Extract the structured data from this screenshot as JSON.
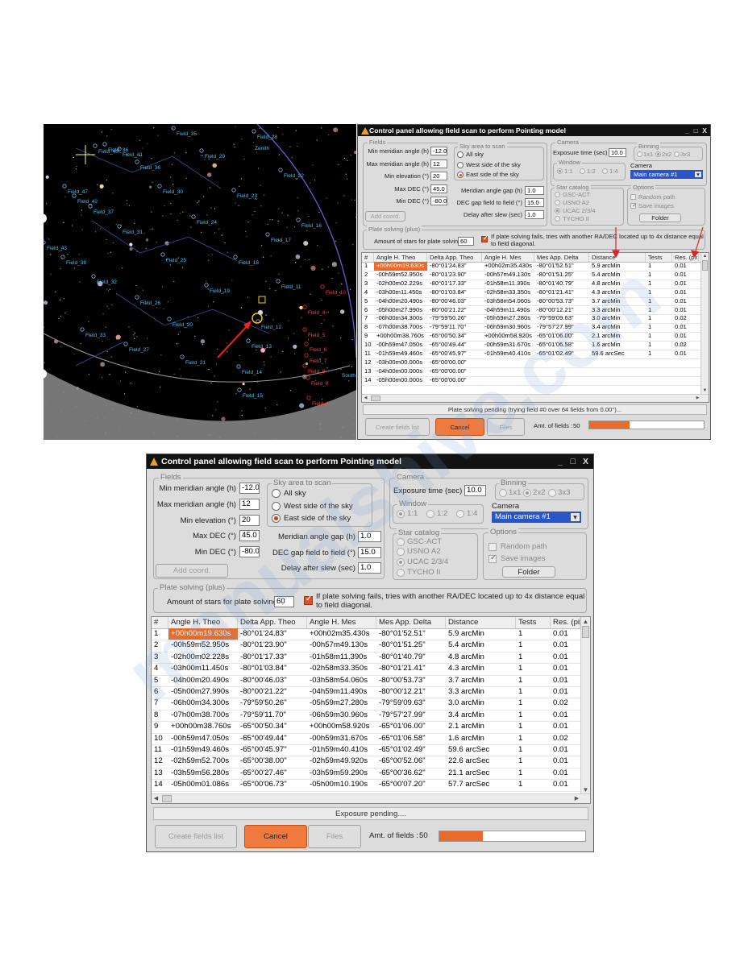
{
  "watermark": "manualshive.com",
  "skymap": {
    "field_labels": [
      "Field_35",
      "Field_36",
      "Field_29",
      "Field_28",
      "Field_40",
      "Field_41",
      "Field_36",
      "Field_22",
      "Field_47",
      "Field_42",
      "Field_30",
      "Field_23",
      "Field_37",
      "Field_24",
      "Field_16",
      "Field_31",
      "Field_17",
      "Field_43",
      "Field_38",
      "Field_25",
      "Field_18",
      "Field_32",
      "Field_19",
      "Field_26",
      "Field_11",
      "Field_20",
      "Field_12",
      "Field_33",
      "Field_27",
      "Field_13",
      "Field_21",
      "Field_14",
      "Field_15",
      "Field_10",
      "Field_4",
      "Field_5",
      "Field_6",
      "Field_7",
      "Field_8",
      "Field_9",
      "Field_3",
      "Zenith",
      "South"
    ]
  },
  "small": {
    "title": "Control panel allowing field scan to perform Pointing model",
    "controls": {
      "min": "_",
      "max": "□",
      "close": "X"
    },
    "fields_group": "Fields",
    "min_meridian_label": "Min meridian angle (h)",
    "min_meridian_value": "-12.0",
    "max_meridian_label": "Max meridian angle (h)",
    "max_meridian_value": "12",
    "min_elev_label": "Min elevation (°)",
    "min_elev_value": "20",
    "max_dec_label": "Max DEC (°)",
    "max_dec_value": "45.0",
    "min_dec_label": "Min DEC (°)",
    "min_dec_value": "-80.0",
    "add_coord": "Add coord.",
    "sky_group": "Sky area to scan",
    "sky_all": "All sky",
    "sky_west": "West side of the sky",
    "sky_east": "East side of the sky",
    "mer_gap_label": "Meridian angle gap (h)",
    "mer_gap_value": "1.0",
    "dec_gap_label": "DEC gap field to field (°)",
    "dec_gap_value": "15.0",
    "delay_label": "Delay after slew (sec)",
    "delay_value": "1.0",
    "camera_group": "Camera",
    "exposure_label": "Exposure time (sec)",
    "exposure_value": "10.0",
    "binning_group": "Binning",
    "bin_1": "1x1",
    "bin_2": "2x2",
    "bin_3": "3x3",
    "window_group": "Window",
    "win_1": "1:1",
    "win_2": "1:2",
    "win_3": "1:4",
    "camera_label": "Camera",
    "camera_value": "Main camera #1",
    "catalog_group": "Star catalog",
    "cat_1": "GSC-ACT",
    "cat_2": "USNO A2",
    "cat_3": "UCAC 2/3/4",
    "cat_4": "TYCHO II",
    "options_group": "Options",
    "opt_random": "Random path",
    "opt_save": "Save images",
    "folder": "Folder",
    "plate_group": "Plate solving (plus)",
    "stars_label": "Amount of stars for plate solving",
    "stars_value": "60",
    "plate_note_1": "If plate solving fails, tries with another RA/DEC located up to 4x distance equal",
    "plate_note_2": "to field diagonal.",
    "table_headers": [
      "#",
      "Angle H. Theo",
      "Delta App. Theo",
      "Angle H. Mes",
      "Mes App. Delta",
      "Distance",
      "Tests",
      "Res. (px"
    ],
    "rows": [
      [
        "1",
        "+00h00m19.630s",
        "-80°01'24.83\"",
        "+00h02m35.430s",
        "-80°01'52.51\"",
        "5.9 arcMin",
        "1",
        "0.01"
      ],
      [
        "2",
        "-00h59m52.950s",
        "-80°01'23.90\"",
        "-00h57m49.130s",
        "-80°01'51.25\"",
        "5.4 arcMin",
        "1",
        "0.01"
      ],
      [
        "3",
        "-02h00m02.229s",
        "-80°01'17.33\"",
        "-01h58m11.390s",
        "-80°01'40.79\"",
        "4.8 arcMin",
        "1",
        "0.01"
      ],
      [
        "4",
        "-03h00m11.450s",
        "-80°01'03.84\"",
        "-02h58m33.350s",
        "-80°01'21.41\"",
        "4.3 arcMin",
        "1",
        "0.01"
      ],
      [
        "5",
        "-04h00m20.490s",
        "-80°00'46.03\"",
        "-03h58m54.060s",
        "-80°00'53.73\"",
        "3.7 arcMin",
        "1",
        "0.01"
      ],
      [
        "6",
        "-05h00m27.990s",
        "-80°00'21.22\"",
        "-04h59m11.490s",
        "-80°00'12.21\"",
        "3.3 arcMin",
        "1",
        "0.01"
      ],
      [
        "7",
        "-06h00m34.300s",
        "-79°59'50.26\"",
        "-05h59m27.280s",
        "-79°59'09.63\"",
        "3.0 arcMin",
        "1",
        "0.02"
      ],
      [
        "8",
        "-07h00m38.700s",
        "-79°59'11.70\"",
        "-06h59m30.960s",
        "-79°57'27.99\"",
        "3.4 arcMin",
        "1",
        "0.01"
      ],
      [
        "9",
        "+00h00m38.760s",
        "-65°00'50.34\"",
        "+00h00m58.920s",
        "-65°01'06.00\"",
        "2.1 arcMin",
        "1",
        "0.01"
      ],
      [
        "10",
        "-00h59m47.050s",
        "-65°00'49.44\"",
        "-00h59m31.670s",
        "-65°01'06.58\"",
        "1.6 arcMin",
        "1",
        "0.02"
      ],
      [
        "11",
        "-01h59m49.460s",
        "-65°00'45.97\"",
        "-01h59m40.410s",
        "-65°01'02.49\"",
        "59.6 arcSec",
        "1",
        "0.01"
      ],
      [
        "12",
        "-03h00m00.000s",
        "-65°00'00.00\"",
        "",
        "",
        "",
        "",
        ""
      ],
      [
        "13",
        "-04h00m00.000s",
        "-65°00'00.00\"",
        "",
        "",
        "",
        "",
        ""
      ],
      [
        "14",
        "-05h00m00.000s",
        "-65°00'00.00\"",
        "",
        "",
        "",
        "",
        ""
      ]
    ],
    "status": "Plate solving pending (trying field #0 over 64 fields from 0.00°)...",
    "create_btn": "Create fields list",
    "cancel_btn": "Cancel",
    "files_btn": "Files",
    "amt_label": "Amt. of fields :",
    "amt_value": "50",
    "progress": 0.35
  },
  "big": {
    "title": "Control panel allowing field scan to perform Pointing model",
    "controls": {
      "min": "_",
      "max": "□",
      "close": "X"
    },
    "fields_group": "Fields",
    "min_meridian_label": "Min meridian angle (h)",
    "min_meridian_value": "-12.0",
    "max_meridian_label": "Max meridian angle (h)",
    "max_meridian_value": "12",
    "min_elev_label": "Min elevation (°)",
    "min_elev_value": "20",
    "max_dec_label": "Max DEC (°)",
    "max_dec_value": "45.0",
    "min_dec_label": "Min DEC (°)",
    "min_dec_value": "-80.0",
    "add_coord": "Add coord.",
    "sky_group": "Sky area to scan",
    "sky_all": "All sky",
    "sky_west": "West side of the sky",
    "sky_east": "East side of the sky",
    "mer_gap_label": "Meridian angle gap (h)",
    "mer_gap_value": "1.0",
    "dec_gap_label": "DEC gap field to field (°)",
    "dec_gap_value": "15.0",
    "delay_label": "Delay after slew (sec)",
    "delay_value": "1.0",
    "camera_group": "Camera",
    "exposure_label": "Exposure time (sec)",
    "exposure_value": "10.0",
    "binning_group": "Binning",
    "bin_1": "1x1",
    "bin_2": "2x2",
    "bin_3": "3x3",
    "window_group": "Window",
    "win_1": "1:1",
    "win_2": "1:2",
    "win_3": "1:4",
    "camera_label": "Camera",
    "camera_value": "Main camera #1",
    "catalog_group": "Star catalog",
    "cat_1": "GSC-ACT",
    "cat_2": "USNO A2",
    "cat_3": "UCAC 2/3/4",
    "cat_4": "TYCHO II",
    "options_group": "Options",
    "opt_random": "Random path",
    "opt_save": "Save images",
    "folder": "Folder",
    "plate_group": "Plate solving (plus)",
    "stars_label": "Amount of stars for plate solving",
    "stars_value": "60",
    "plate_note_1": "If plate solving fails, tries with another RA/DEC located up to 4x distance equal",
    "plate_note_2": "to field diagonal.",
    "table_headers": [
      "#",
      "Angle H. Theo",
      "Delta App. Theo",
      "Angle H. Mes",
      "Mes App. Delta",
      "Distance",
      "Tests",
      "Res. (pix"
    ],
    "rows": [
      [
        "1",
        "+00h00m19.630s",
        "-80°01'24.83\"",
        "+00h02m35.430s",
        "-80°01'52.51\"",
        "5.9 arcMin",
        "1",
        "0.01"
      ],
      [
        "2",
        "-00h59m52.950s",
        "-80°01'23.90\"",
        "-00h57m49.130s",
        "-80°01'51.25\"",
        "5.4 arcMin",
        "1",
        "0.01"
      ],
      [
        "3",
        "-02h00m02.228s",
        "-80°01'17.33\"",
        "-01h58m11.390s",
        "-80°01'40.79\"",
        "4.8 arcMin",
        "1",
        "0.01"
      ],
      [
        "4",
        "-03h00m11.450s",
        "-80°01'03.84\"",
        "-02h58m33.350s",
        "-80°01'21.41\"",
        "4.3 arcMin",
        "1",
        "0.01"
      ],
      [
        "5",
        "-04h00m20.490s",
        "-80°00'46.03\"",
        "-03h58m54.060s",
        "-80°00'53.73\"",
        "3.7 arcMin",
        "1",
        "0.01"
      ],
      [
        "6",
        "-05h00m27.990s",
        "-80°00'21.22\"",
        "-04h59m11.490s",
        "-80°00'12.21\"",
        "3.3 arcMin",
        "1",
        "0.01"
      ],
      [
        "7",
        "-06h00m34.300s",
        "-79°59'50.26\"",
        "-05h59m27.280s",
        "-79°59'09.63\"",
        "3.0 arcMin",
        "1",
        "0.02"
      ],
      [
        "8",
        "-07h00m38.700s",
        "-79°59'11.70\"",
        "-06h59m30.960s",
        "-79°57'27.99\"",
        "3.4 arcMin",
        "1",
        "0.01"
      ],
      [
        "9",
        "+00h00m38.760s",
        "-65°00'50.34\"",
        "+00h00m58.920s",
        "-65°01'06.00\"",
        "2.1 arcMin",
        "1",
        "0.01"
      ],
      [
        "10",
        "-00h59m47.050s",
        "-65°00'49.44\"",
        "-00h59m31.670s",
        "-65°01'06.58\"",
        "1.6 arcMin",
        "1",
        "0.02"
      ],
      [
        "11",
        "-01h59m49.460s",
        "-65°00'45.97\"",
        "-01h59m40.410s",
        "-65°01'02.49\"",
        "59.6 arcSec",
        "1",
        "0.01"
      ],
      [
        "12",
        "-02h59m52.700s",
        "-65°00'38.00\"",
        "-02h59m49.920s",
        "-65°00'52.06\"",
        "22.6 arcSec",
        "1",
        "0.01"
      ],
      [
        "13",
        "-03h59m56.280s",
        "-65°00'27.46\"",
        "-03h59m59.290s",
        "-65°00'36.62\"",
        "21.1 arcSec",
        "1",
        "0.01"
      ],
      [
        "14",
        "-05h00m01.086s",
        "-65°00'06.73\"",
        "-05h00m10.190s",
        "-65°00'07.20\"",
        "57.7 arcSec",
        "1",
        "0.01"
      ]
    ],
    "status": "Exposure pending....",
    "create_btn": "Create fields list",
    "cancel_btn": "Cancel",
    "files_btn": "Files",
    "amt_label": "Amt. of fields :",
    "amt_value": "50",
    "progress": 0.3
  },
  "colors": {
    "accent": "#ea6a28",
    "title_bg": "#121212",
    "window_bg": "#dcdcdc",
    "selection": "#2a55c8"
  }
}
